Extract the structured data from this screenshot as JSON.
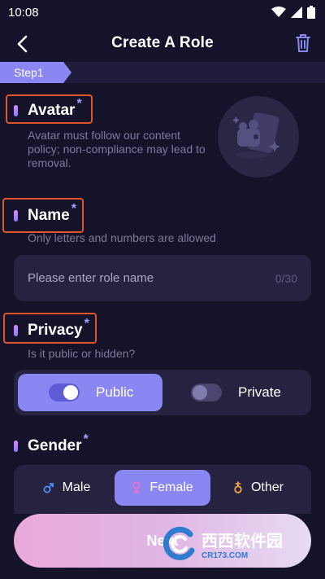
{
  "status_bar": {
    "time": "10:08"
  },
  "header": {
    "title": "Create A Role"
  },
  "step": {
    "label": "Step1"
  },
  "avatar": {
    "label": "Avatar",
    "required_mark": "*",
    "helper": "Avatar must follow our content policy; non-compliance may lead to removal."
  },
  "name": {
    "label": "Name",
    "required_mark": "*",
    "helper": "Only letters and numbers are allowed",
    "placeholder": "Please enter role name",
    "counter": "0/30"
  },
  "privacy": {
    "label": "Privacy",
    "required_mark": "*",
    "helper": "Is it public or hidden?",
    "options": [
      {
        "label": "Public",
        "selected": true
      },
      {
        "label": "Private",
        "selected": false
      }
    ]
  },
  "gender": {
    "label": "Gender",
    "required_mark": "*",
    "options": [
      {
        "label": "Male",
        "icon": "male-icon",
        "selected": false
      },
      {
        "label": "Female",
        "icon": "female-icon",
        "selected": true
      },
      {
        "label": "Other",
        "icon": "other-gender-icon",
        "selected": false
      }
    ]
  },
  "footer": {
    "next_label": "Next"
  },
  "watermark": {
    "text": "西西软件园",
    "sub": "CR173.COM"
  },
  "colors": {
    "background": "#15132a",
    "accent": "#8a87f3",
    "highlight": "#e0562a",
    "card": "#262340"
  }
}
